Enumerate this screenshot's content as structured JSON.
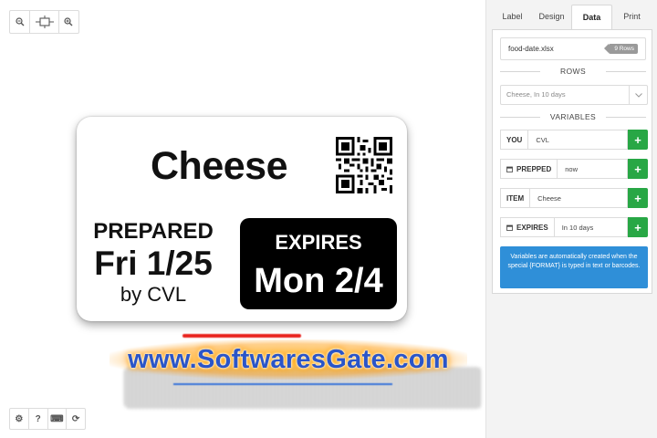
{
  "toolbar_top": {
    "items": [
      {
        "icon": "zoom-out-icon"
      },
      {
        "icon": "fit-to-screen-icon"
      },
      {
        "icon": "zoom-in-icon"
      }
    ]
  },
  "toolbar_bottom": {
    "items": [
      {
        "icon": "settings-icon",
        "glyph": "⚙"
      },
      {
        "icon": "help-icon",
        "glyph": "?"
      },
      {
        "icon": "keyboard-icon",
        "glyph": "⌨"
      },
      {
        "icon": "refresh-icon",
        "glyph": "⟳"
      }
    ]
  },
  "label": {
    "item": "Cheese",
    "prepared_heading": "PREPARED",
    "prepared_date": "Fri 1/25",
    "prepared_by": "by CVL",
    "expires_heading": "EXPIRES",
    "expires_date": "Mon 2/4"
  },
  "watermark": "www.SoftwaresGate.com",
  "tabs": [
    {
      "label": "Label",
      "active": false
    },
    {
      "label": "Design",
      "active": false
    },
    {
      "label": "Data",
      "active": true
    },
    {
      "label": "Print",
      "active": false
    }
  ],
  "data_panel": {
    "file_name": "food-date.xlsx",
    "rows_badge": "9 Rows",
    "rows_heading": "ROWS",
    "row_select_value": "Cheese, In 10 days",
    "variables_heading": "VARIABLES",
    "variables": [
      {
        "key": "YOU",
        "value": "CVL",
        "icon": "",
        "add": "+"
      },
      {
        "key": "PREPPED",
        "value": "now",
        "icon": "calendar-icon",
        "add": "+"
      },
      {
        "key": "ITEM",
        "value": "Cheese",
        "icon": "",
        "add": "+"
      },
      {
        "key": "EXPIRES",
        "value": "In 10 days",
        "icon": "calendar-icon",
        "add": "+"
      }
    ],
    "info_text": "Variables are automatically created when the special {FORMAT} is typed in text or barcodes."
  },
  "colors": {
    "add_button": "#28a745",
    "info_box": "#2f8fd8",
    "expires_box": "#000000"
  }
}
